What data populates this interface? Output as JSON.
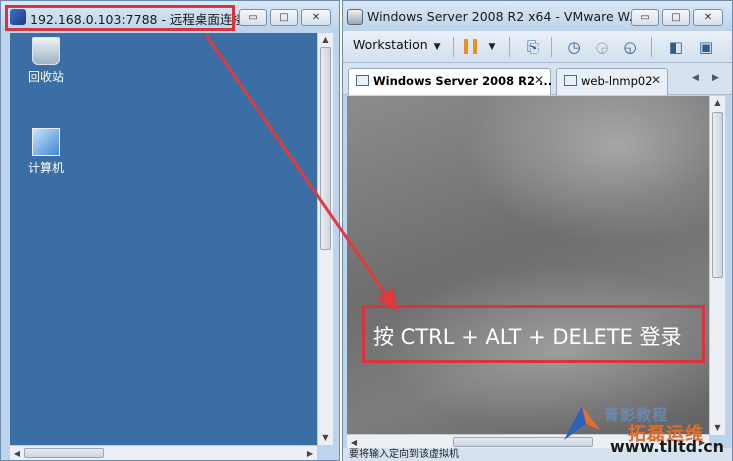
{
  "remote_window": {
    "title": "192.168.0.103:7788 - 远程桌面连接",
    "buttons": {
      "minimize": "▭",
      "maximize": "□",
      "close": "✕"
    },
    "desktop_icons": [
      {
        "label": "回收站",
        "icon": "recycle-bin-icon"
      },
      {
        "label": "计算机",
        "icon": "computer-icon"
      }
    ]
  },
  "vmware_window": {
    "title": "Windows Server 2008 R2 x64 - VMware W...",
    "buttons": {
      "minimize": "▭",
      "maximize": "□",
      "close": "✕"
    },
    "toolbar": {
      "workstation_label": "Workstation"
    },
    "tabs": [
      {
        "label": "Windows Server 2008 R2 ...",
        "active": true
      },
      {
        "label": "web-lnmp02",
        "active": false
      }
    ],
    "screen": {
      "login_prompt": "按 CTRL + ALT + DELETE 登录"
    },
    "status_text": "要将输入定向到该虚拟机"
  },
  "watermark": {
    "brand": "拓磊运维",
    "brand_top": "青影教程",
    "url": "www.tlltd.cn"
  },
  "colors": {
    "desktop": "#3b6ea5",
    "highlight": "#d9343a",
    "pause": "#e79124"
  }
}
